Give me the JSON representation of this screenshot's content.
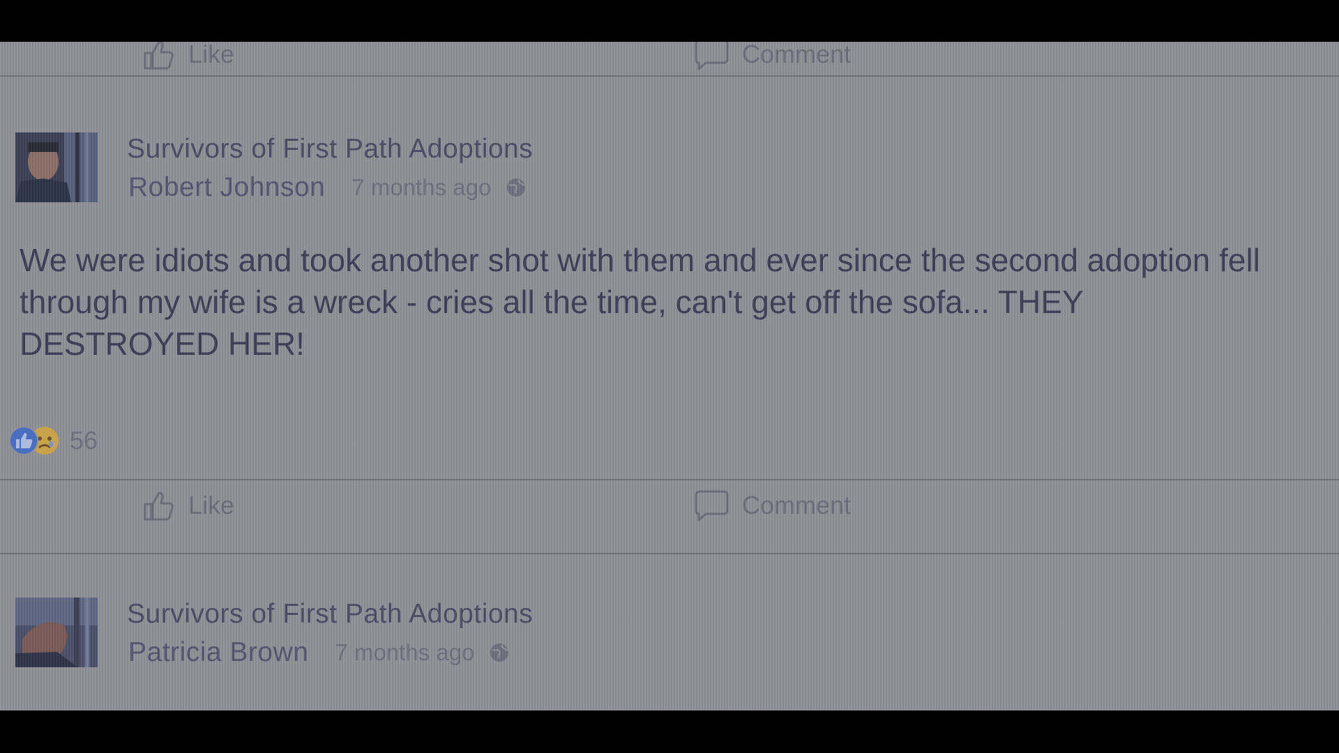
{
  "colors": {
    "screen_background": "#8f8f97",
    "text_primary": "#3c3c55",
    "text_secondary": "#6e6e7c",
    "like_reaction_blue": "#4a6fc0",
    "sad_reaction_yellow": "#c8a34a"
  },
  "top_actions": {
    "like_label": "Like",
    "like_icon": "thumbs-up-icon",
    "comment_label": "Comment",
    "comment_icon": "comment-bubble-icon"
  },
  "posts": [
    {
      "group": "Survivors of First Path Adoptions",
      "author": "Robert Johnson",
      "time": "7 months ago",
      "privacy_icon": "globe-icon",
      "text": "We were idiots and took another shot with them and ever since the second adoption fell through my wife is a wreck - cries all the time, can't get off the sofa... THEY DESTROYED HER!",
      "reactions": {
        "icons": [
          "like-reaction-icon",
          "sad-reaction-icon"
        ],
        "count": "56"
      },
      "actions": {
        "like_label": "Like",
        "comment_label": "Comment"
      }
    },
    {
      "group": "Survivors of First Path Adoptions",
      "author": "Patricia Brown",
      "time": "7 months ago",
      "privacy_icon": "globe-icon"
    }
  ]
}
